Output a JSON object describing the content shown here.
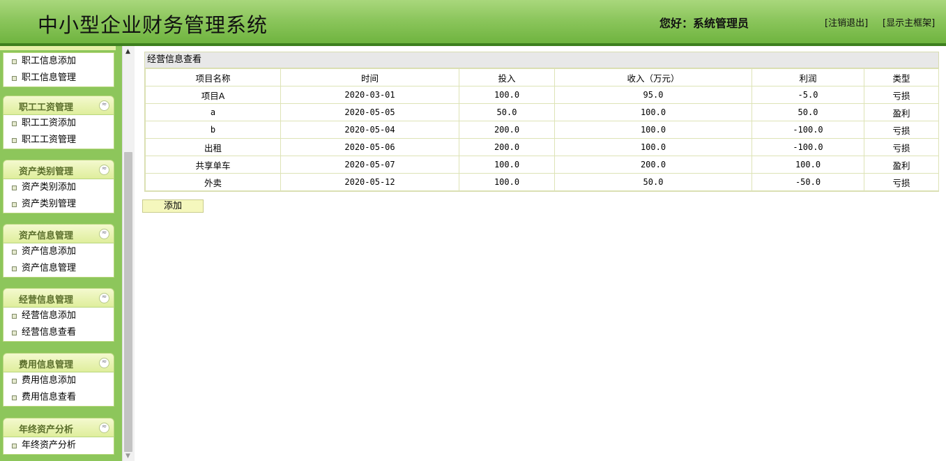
{
  "header": {
    "title": "中小型企业财务管理系统",
    "greeting": "您好：系统管理员",
    "logout_link": "[注销退出]",
    "main_frame_link": "[显示主框架]"
  },
  "sidebar": {
    "panels": [
      {
        "items": [
          "职工信息添加",
          "职工信息管理"
        ]
      },
      {
        "title": "职工工资管理",
        "items": [
          "职工工资添加",
          "职工工资管理"
        ]
      },
      {
        "title": "资产类别管理",
        "items": [
          "资产类别添加",
          "资产类别管理"
        ]
      },
      {
        "title": "资产信息管理",
        "items": [
          "资产信息添加",
          "资产信息管理"
        ]
      },
      {
        "title": "经营信息管理",
        "items": [
          "经营信息添加",
          "经营信息查看"
        ]
      },
      {
        "title": "费用信息管理",
        "items": [
          "费用信息添加",
          "费用信息查看"
        ]
      },
      {
        "title": "年终资产分析",
        "items": [
          "年终资产分析"
        ]
      }
    ],
    "collapse_glyph": "≈"
  },
  "main": {
    "caption": "经营信息查看",
    "columns": [
      "项目名称",
      "时间",
      "投入",
      "收入（万元）",
      "利润",
      "类型"
    ],
    "rows": [
      [
        "项目A",
        "2020-03-01",
        "100.0",
        "95.0",
        "-5.0",
        "亏损"
      ],
      [
        "a",
        "2020-05-05",
        "50.0",
        "100.0",
        "50.0",
        "盈利"
      ],
      [
        "b",
        "2020-05-04",
        "200.0",
        "100.0",
        "-100.0",
        "亏损"
      ],
      [
        "出租",
        "2020-05-06",
        "200.0",
        "100.0",
        "-100.0",
        "亏损"
      ],
      [
        "共享单车",
        "2020-05-07",
        "100.0",
        "200.0",
        "100.0",
        "盈利"
      ],
      [
        "外卖",
        "2020-05-12",
        "100.0",
        "50.0",
        "-50.0",
        "亏损"
      ]
    ],
    "add_button": "添加"
  },
  "colors": {
    "header_green": "#8cc65d",
    "header_rule": "#3d7f1e",
    "sidebar_green": "#8dc65b",
    "panel_title": "#5a6e2b",
    "table_border": "#dde3b6",
    "button_bg": "#f5f7bd"
  }
}
